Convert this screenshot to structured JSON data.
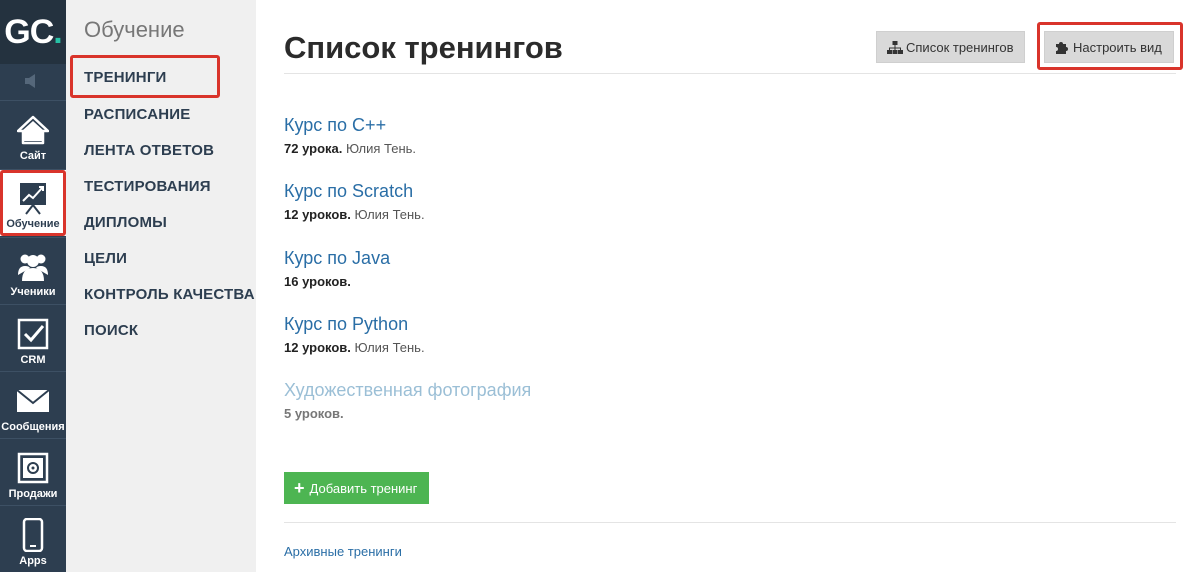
{
  "logo": {
    "text_main": "GC",
    "text_dot": "."
  },
  "rail": {
    "items": [
      {
        "label": "Сайт",
        "icon": "home-icon"
      },
      {
        "label": "Обучение",
        "icon": "chart-board-icon"
      },
      {
        "label": "Ученики",
        "icon": "users-icon"
      },
      {
        "label": "CRM",
        "icon": "checkbox-icon"
      },
      {
        "label": "Сообщения",
        "icon": "envelope-icon"
      },
      {
        "label": "Продажи",
        "icon": "safe-icon"
      },
      {
        "label": "Apps",
        "icon": "phone-icon"
      }
    ],
    "active_index": 1
  },
  "sidebar": {
    "title": "Обучение",
    "items": [
      {
        "label": "ТРЕНИНГИ"
      },
      {
        "label": "РАСПИСАНИЕ"
      },
      {
        "label": "ЛЕНТА ОТВЕТОВ"
      },
      {
        "label": "ТЕСТИРОВАНИЯ"
      },
      {
        "label": "ДИПЛОМЫ"
      },
      {
        "label": "ЦЕЛИ"
      },
      {
        "label": "КОНТРОЛЬ КАЧЕСТВА"
      },
      {
        "label": "ПОИСК"
      }
    ]
  },
  "header": {
    "title": "Список тренингов",
    "btn_list": "Список тренингов",
    "btn_customize": "Настроить вид"
  },
  "courses": [
    {
      "title": "Курс по C++",
      "count": "72 урока.",
      "author": " Юлия Тень."
    },
    {
      "title": "Курс по Scratch",
      "count": "12 уроков.",
      "author": " Юлия Тень."
    },
    {
      "title": "Курс по Java",
      "count": "16 уроков.",
      "author": ""
    },
    {
      "title": "Курс по Python",
      "count": "12 уроков.",
      "author": " Юлия Тень."
    },
    {
      "title": "Художественная фотография",
      "count": "5 уроков.",
      "author": ""
    }
  ],
  "actions": {
    "add_training": "Добавить тренинг",
    "archive_link": "Архивные тренинги"
  },
  "colors": {
    "rail_bg": "#2d3e50",
    "accent_link": "#2a6ea6",
    "add_button": "#4db552",
    "highlight": "#d9342b"
  }
}
